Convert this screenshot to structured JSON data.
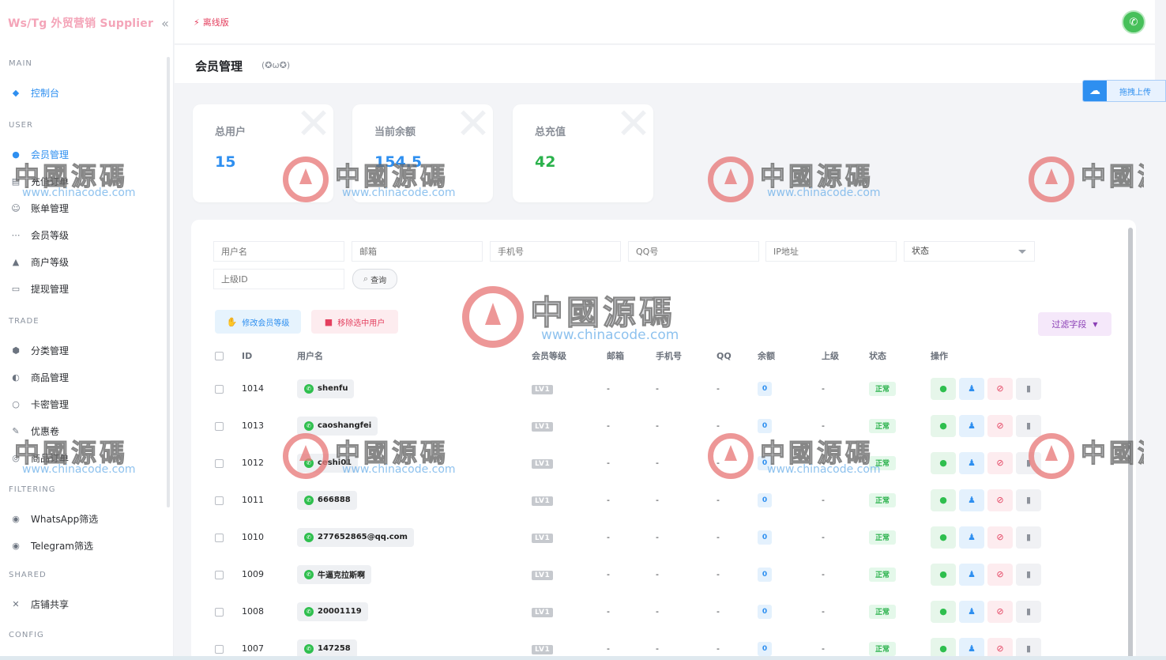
{
  "sidebar": {
    "brand": "Ws/Tg 外贸营销 Supplier",
    "collapse_icon": "«",
    "sections": [
      {
        "label": "MAIN",
        "items": [
          {
            "label": "控制台",
            "icon": "dashboard-icon",
            "glyph": "◆",
            "active": true
          }
        ]
      },
      {
        "label": "USER",
        "items": [
          {
            "label": "会员管理",
            "icon": "user-icon",
            "glyph": "●",
            "active": true
          },
          {
            "label": "充值订单",
            "icon": "order-icon",
            "glyph": "▤"
          },
          {
            "label": "账单管理",
            "icon": "bill-icon",
            "glyph": "☺"
          },
          {
            "label": "会员等级",
            "icon": "share-icon",
            "glyph": "⋯"
          },
          {
            "label": "商户等级",
            "icon": "rocket-icon",
            "glyph": "▲"
          },
          {
            "label": "提现管理",
            "icon": "withdraw-icon",
            "glyph": "▭"
          }
        ]
      },
      {
        "label": "TRADE",
        "items": [
          {
            "label": "分类管理",
            "icon": "category-icon",
            "glyph": "⬢"
          },
          {
            "label": "商品管理",
            "icon": "product-icon",
            "glyph": "◐"
          },
          {
            "label": "卡密管理",
            "icon": "card-icon",
            "glyph": "○"
          },
          {
            "label": "优惠卷",
            "icon": "coupon-icon",
            "glyph": "✎"
          },
          {
            "label": "商品订单",
            "icon": "goods-order-icon",
            "glyph": "◎"
          }
        ]
      },
      {
        "label": "FILTERING",
        "items": [
          {
            "label": "WhatsApp筛选",
            "icon": "whatsapp-filter-icon",
            "glyph": "◉"
          },
          {
            "label": "Telegram筛选",
            "icon": "telegram-filter-icon",
            "glyph": "◉"
          }
        ]
      },
      {
        "label": "SHARED",
        "items": [
          {
            "label": "店铺共享",
            "icon": "store-share-icon",
            "glyph": "✕"
          }
        ]
      },
      {
        "label": "CONFIG",
        "items": []
      }
    ]
  },
  "topbar": {
    "offline_label": "离线版",
    "avatar_glyph": "✆"
  },
  "page": {
    "title": "会员管理",
    "subtitle": "(✪ω✪)"
  },
  "upload": {
    "label": "拖拽上传"
  },
  "stats": [
    {
      "label": "总用户",
      "value": "15",
      "color": "#2e8ff0"
    },
    {
      "label": "当前余额",
      "value": "154.5",
      "color": "#2e8ff0"
    },
    {
      "label": "总充值",
      "value": "42",
      "color": "#2bb24c"
    }
  ],
  "filters": {
    "username": "用户名",
    "email": "邮箱",
    "phone": "手机号",
    "qq": "QQ号",
    "ip": "IP地址",
    "status": "状态",
    "parent_id": "上级ID",
    "query_button": "查询"
  },
  "actions": {
    "change_level": "修改会员等级",
    "remove_selected": "移除选中用户",
    "filter_fields": "过滤字段"
  },
  "table": {
    "headers": {
      "id": "ID",
      "username": "用户名",
      "level": "会员等级",
      "email": "邮箱",
      "phone": "手机号",
      "qq": "QQ",
      "balance": "余额",
      "parent": "上级",
      "status": "状态",
      "ops": "操作"
    },
    "rows": [
      {
        "id": "1014",
        "username": "shenfu",
        "level": "LV1",
        "email": "-",
        "phone": "-",
        "qq": "-",
        "balance": "0",
        "parent": "-",
        "status": "正常"
      },
      {
        "id": "1013",
        "username": "caoshangfei",
        "level": "LV1",
        "email": "-",
        "phone": "-",
        "qq": "-",
        "balance": "0",
        "parent": "-",
        "status": "正常"
      },
      {
        "id": "1012",
        "username": "ceshi01",
        "level": "LV1",
        "email": "-",
        "phone": "-",
        "qq": "-",
        "balance": "0",
        "parent": "-",
        "status": "正常"
      },
      {
        "id": "1011",
        "username": "666888",
        "level": "LV1",
        "email": "-",
        "phone": "-",
        "qq": "-",
        "balance": "0",
        "parent": "-",
        "status": "正常"
      },
      {
        "id": "1010",
        "username": "277652865@qq.com",
        "level": "LV1",
        "email": "-",
        "phone": "-",
        "qq": "-",
        "balance": "0",
        "parent": "-",
        "status": "正常"
      },
      {
        "id": "1009",
        "username": "牛逼克拉斯啊",
        "level": "LV1",
        "email": "-",
        "phone": "-",
        "qq": "-",
        "balance": "0",
        "parent": "-",
        "status": "正常"
      },
      {
        "id": "1008",
        "username": "20001119",
        "level": "LV1",
        "email": "-",
        "phone": "-",
        "qq": "-",
        "balance": "0",
        "parent": "-",
        "status": "正常"
      },
      {
        "id": "1007",
        "username": "147258",
        "level": "LV1",
        "email": "-",
        "phone": "-",
        "qq": "-",
        "balance": "0",
        "parent": "-",
        "status": "正常"
      }
    ]
  },
  "watermark": {
    "text": "中國源碼",
    "url": "www.chinacode.com"
  }
}
